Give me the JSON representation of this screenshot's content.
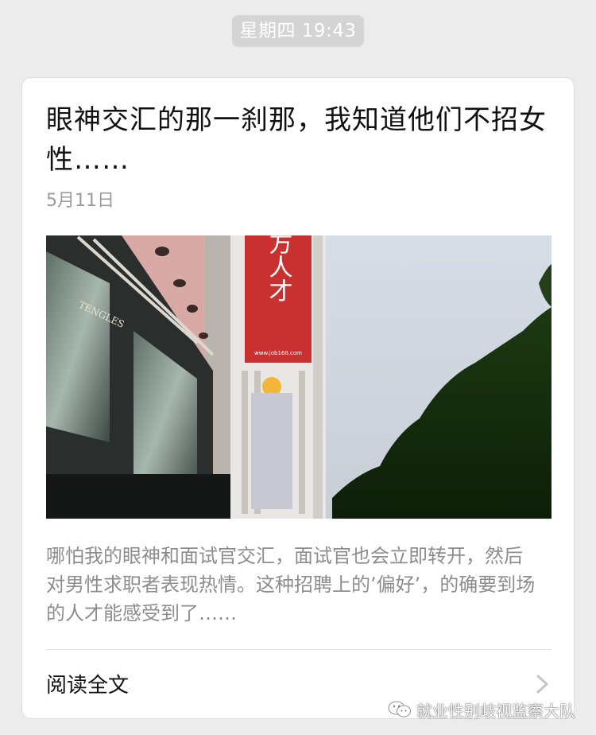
{
  "message": {
    "timestamp": "星期四 19:43"
  },
  "article": {
    "title": "眼神交汇的那一刹那，我知道他们不招女性……",
    "date": "5月11日",
    "cover_image": {
      "sign_text": "南方人才",
      "sign_url": "www.job168.com",
      "storefront_text": "TENGLES"
    },
    "summary": "哪怕我的眼神和面试官交汇，面试官也会立即转开，然后对男性求职者表现热情。这种招聘上的’偏好’，的确要到场的人才能感受到了……",
    "read_more_label": "阅读全文"
  },
  "watermark": {
    "text": "就业性别歧视监察大队",
    "icon": "wechat-logo-icon"
  },
  "colors": {
    "background": "#ececec",
    "card": "#ffffff",
    "pill": "#d4d4d4",
    "title_text": "#111111",
    "secondary_text": "#8d8d8d",
    "sign_red": "#c8312f"
  }
}
